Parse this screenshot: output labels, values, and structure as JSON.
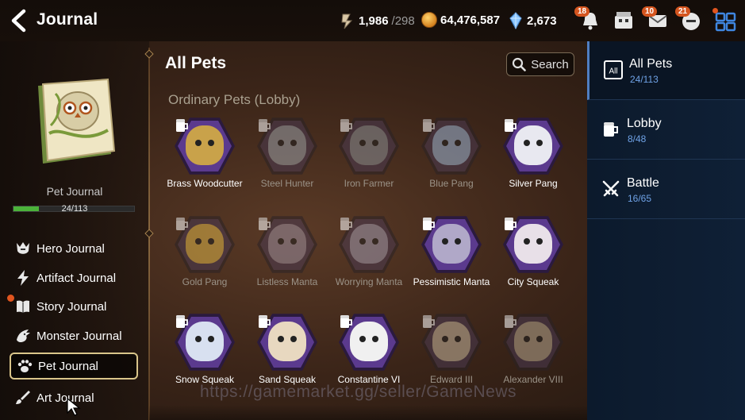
{
  "header": {
    "title": "Journal",
    "resources": [
      {
        "icon": "stamina-icon",
        "value": "1,986",
        "sub": "/298"
      },
      {
        "icon": "gold-coin-icon",
        "value": "64,476,587",
        "sub": ""
      },
      {
        "icon": "crystal-icon",
        "value": "2,673",
        "sub": ""
      }
    ],
    "notifications": [
      {
        "icon": "bell-icon",
        "badge": "18"
      },
      {
        "icon": "shop-icon",
        "badge": ""
      },
      {
        "icon": "mail-icon",
        "badge": "10"
      },
      {
        "icon": "chat-icon",
        "badge": "21"
      },
      {
        "icon": "menu-grid-icon",
        "badge": ""
      }
    ]
  },
  "left_panel": {
    "book_label": "Pet Journal",
    "progress_text": "24/113",
    "progress_fraction": 0.2124,
    "menu": [
      {
        "label": "Hero Journal",
        "icon": "hero-helmet-icon"
      },
      {
        "label": "Artifact Journal",
        "icon": "lightning-icon"
      },
      {
        "label": "Story Journal",
        "icon": "story-book-icon"
      },
      {
        "label": "Monster Journal",
        "icon": "dragon-icon"
      },
      {
        "label": "Pet Journal",
        "icon": "paw-icon"
      },
      {
        "label": "Art Journal",
        "icon": "paint-brush-icon"
      }
    ]
  },
  "main": {
    "title": "All Pets",
    "search_label": "Search",
    "section_title": "Ordinary Pets (Lobby)",
    "pets": [
      {
        "name": "Brass Woodcutter",
        "owned": true,
        "color": "#c9a24a"
      },
      {
        "name": "Steel Hunter",
        "owned": false,
        "color": "#9aa0a8"
      },
      {
        "name": "Iron Farmer",
        "owned": false,
        "color": "#8a8f96"
      },
      {
        "name": "Blue Pang",
        "owned": false,
        "color": "#9fb8d8"
      },
      {
        "name": "Silver Pang",
        "owned": true,
        "color": "#e8e8f0"
      },
      {
        "name": "Gold Pang",
        "owned": false,
        "color": "#e0b54a"
      },
      {
        "name": "Listless Manta",
        "owned": false,
        "color": "#9a8ea0"
      },
      {
        "name": "Worrying Manta",
        "owned": false,
        "color": "#a09ab0"
      },
      {
        "name": "Pessimistic Manta",
        "owned": true,
        "color": "#b0a8c8"
      },
      {
        "name": "City Squeak",
        "owned": true,
        "color": "#e8e0e8"
      },
      {
        "name": "Snow Squeak",
        "owned": true,
        "color": "#d8e0f0"
      },
      {
        "name": "Sand Squeak",
        "owned": true,
        "color": "#e8d8c0"
      },
      {
        "name": "Constantine VI",
        "owned": true,
        "color": "#f0f0f0"
      },
      {
        "name": "Edward III",
        "owned": false,
        "color": "#c8b8a0"
      },
      {
        "name": "Alexander VIII",
        "owned": false,
        "color": "#b8a890"
      }
    ],
    "watermark": "https://gamemarket.gg/seller/GameNews"
  },
  "right_panel": {
    "categories": [
      {
        "label": "All Pets",
        "count": "24/113",
        "icon": "all-icon",
        "active": true
      },
      {
        "label": "Lobby",
        "count": "8/48",
        "icon": "lobby-mug-icon",
        "active": false
      },
      {
        "label": "Battle",
        "count": "16/65",
        "icon": "crossed-swords-icon",
        "active": false
      }
    ]
  },
  "colors": {
    "accent_blue": "#4f7ec2",
    "progress_green": "#4bb33a",
    "badge_orange": "#d4551f",
    "pet_frame_purple": "#5b3a8e"
  }
}
